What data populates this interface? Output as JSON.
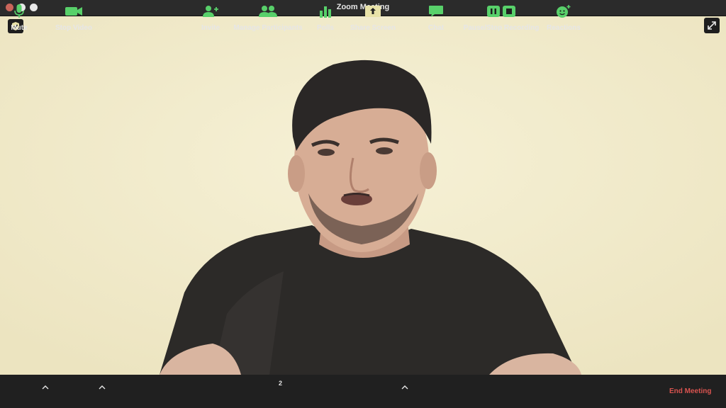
{
  "window": {
    "title": "Zoom Meeting"
  },
  "video": {
    "icons": [
      "shield-icon",
      "fullscreen-icon"
    ]
  },
  "toolbar": {
    "mute_label": "Mute",
    "stop_video_label": "Stop Video",
    "invite_label": "Invite",
    "manage_participants_label": "Manage Participants",
    "participants_count": "2",
    "polls_label": "Polls",
    "share_screen_label": "Share Screen",
    "chat_label": "Chat",
    "pause_stop_recording_label": "Pause/Stop Recording",
    "reactions_label": "Reactions",
    "end_meeting_label": "End Meeting"
  },
  "colors": {
    "icon_green": "#58d06a",
    "share_accent": "#e8e2a8",
    "end_meeting": "#d9534f",
    "toolbar_bg": "#202020",
    "video_bg": "#f2edce"
  }
}
